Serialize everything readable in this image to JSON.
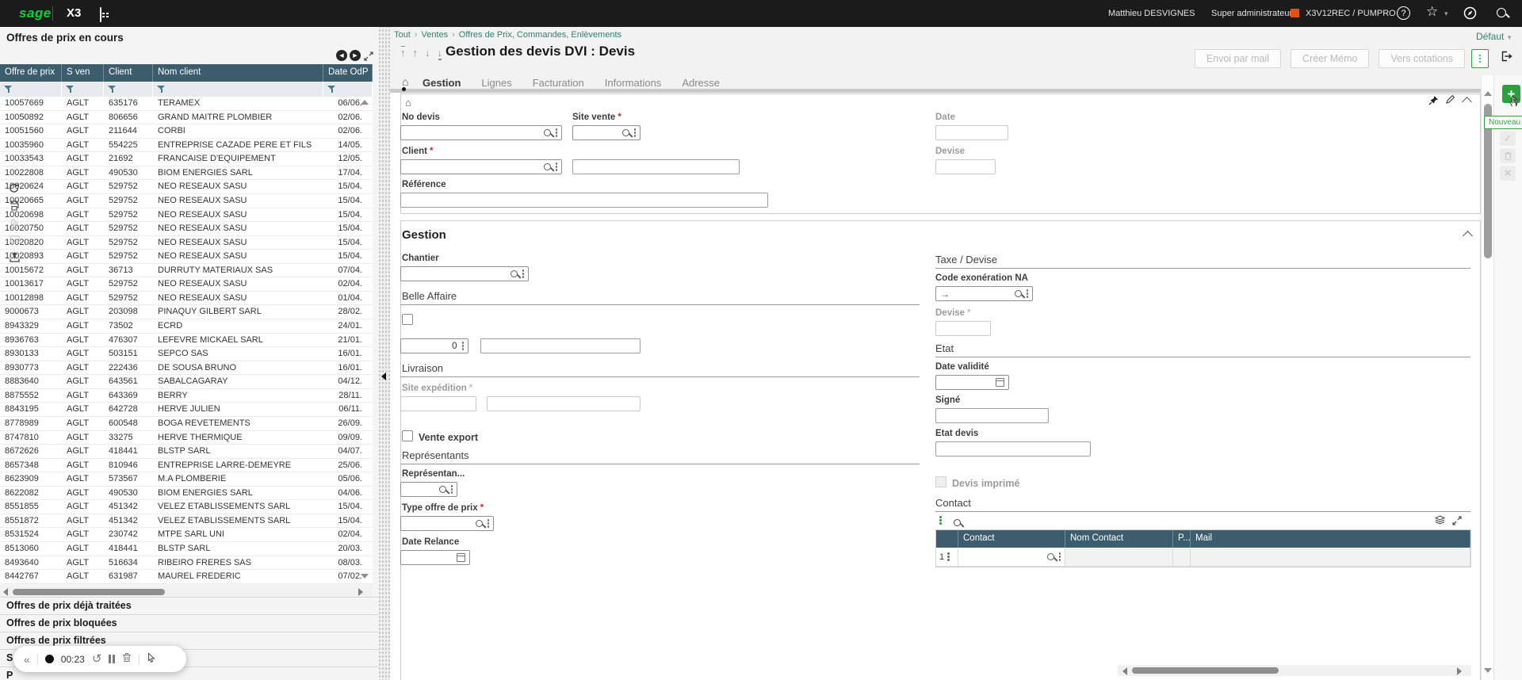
{
  "colors": {
    "accent_green": "#2aa13c",
    "topbar_bg": "#1b1b1b",
    "table_header_bg": "#3b5d6e",
    "link_teal": "#35806b",
    "env_orange": "#e05206"
  },
  "topbar": {
    "brand": "sage",
    "product": "X3",
    "user": "Matthieu DESVIGNES",
    "role": "Super administrateur",
    "environment": "X3V12REC / PUMPRO"
  },
  "context_bar": {
    "breadcrumb": [
      "Tout",
      "Ventes",
      "Offres de Prix, Commandes, Enlèvements"
    ],
    "view_label": "Défaut"
  },
  "left_panel": {
    "title": "Offres de prix en cours",
    "table": {
      "columns": [
        "Offre de prix",
        "S ven",
        "Client",
        "Nom client",
        "Date OdP"
      ],
      "rows": [
        [
          "10057669",
          "AGLT",
          "635176",
          "TERAMEX",
          "06/06."
        ],
        [
          "10050892",
          "AGLT",
          "806656",
          "GRAND MAITRE PLOMBIER",
          "02/06."
        ],
        [
          "10051560",
          "AGLT",
          "211644",
          "CORBI",
          "02/06."
        ],
        [
          "10035960",
          "AGLT",
          "554225",
          "ENTREPRISE CAZADE PERE ET FILS",
          "14/05."
        ],
        [
          "10033543",
          "AGLT",
          "21692",
          "FRANCAISE D'EQUIPEMENT",
          "12/05."
        ],
        [
          "10022808",
          "AGLT",
          "490530",
          "BIOM ENERGIES SARL",
          "17/04."
        ],
        [
          "10020624",
          "AGLT",
          "529752",
          "NEO RESEAUX SASU",
          "15/04."
        ],
        [
          "10020665",
          "AGLT",
          "529752",
          "NEO RESEAUX SASU",
          "15/04."
        ],
        [
          "10020698",
          "AGLT",
          "529752",
          "NEO RESEAUX SASU",
          "15/04."
        ],
        [
          "10020750",
          "AGLT",
          "529752",
          "NEO RESEAUX SASU",
          "15/04."
        ],
        [
          "10020820",
          "AGLT",
          "529752",
          "NEO RESEAUX SASU",
          "15/04."
        ],
        [
          "10020893",
          "AGLT",
          "529752",
          "NEO RESEAUX SASU",
          "15/04."
        ],
        [
          "10015672",
          "AGLT",
          "36713",
          "DURRUTY MATERIAUX SAS",
          "07/04."
        ],
        [
          "10013617",
          "AGLT",
          "529752",
          "NEO RESEAUX SASU",
          "02/04."
        ],
        [
          "10012898",
          "AGLT",
          "529752",
          "NEO RESEAUX SASU",
          "01/04."
        ],
        [
          "9000673",
          "AGLT",
          "203098",
          "PINAQUY GILBERT SARL",
          "28/02."
        ],
        [
          "8943329",
          "AGLT",
          "73502",
          "ECRD",
          "24/01."
        ],
        [
          "8936763",
          "AGLT",
          "476307",
          "LEFEVRE MICKAEL SARL",
          "21/01."
        ],
        [
          "8930133",
          "AGLT",
          "503151",
          "SEPCO SAS",
          "16/01."
        ],
        [
          "8930773",
          "AGLT",
          "222436",
          "DE SOUSA BRUNO",
          "16/01."
        ],
        [
          "8883640",
          "AGLT",
          "643561",
          "SABALCAGARAY",
          "04/12."
        ],
        [
          "8875552",
          "AGLT",
          "643369",
          "BERRY",
          "28/11."
        ],
        [
          "8843195",
          "AGLT",
          "642728",
          "HERVE JULIEN",
          "06/11."
        ],
        [
          "8778989",
          "AGLT",
          "600548",
          "BOGA REVETEMENTS",
          "26/09."
        ],
        [
          "8747810",
          "AGLT",
          "33275",
          "HERVE THERMIQUE",
          "09/09."
        ],
        [
          "8672626",
          "AGLT",
          "418441",
          "BLSTP SARL",
          "04/07."
        ],
        [
          "8657348",
          "AGLT",
          "810946",
          "ENTREPRISE LARRE-DEMEYRE",
          "25/06."
        ],
        [
          "8623909",
          "AGLT",
          "573567",
          "M.A PLOMBERIE",
          "05/06."
        ],
        [
          "8622082",
          "AGLT",
          "490530",
          "BIOM ENERGIES SARL",
          "04/06."
        ],
        [
          "8551855",
          "AGLT",
          "451342",
          "VELEZ ETABLISSEMENTS SARL",
          "15/04."
        ],
        [
          "8551872",
          "AGLT",
          "451342",
          "VELEZ ETABLISSEMENTS SARL",
          "15/04."
        ],
        [
          "8531524",
          "AGLT",
          "230742",
          "MTPE SARL UNI",
          "02/04."
        ],
        [
          "8513060",
          "AGLT",
          "418441",
          "BLSTP SARL",
          "20/03."
        ],
        [
          "8493640",
          "AGLT",
          "516634",
          "RIBEIRO FRERES SAS",
          "08/03."
        ],
        [
          "8442767",
          "AGLT",
          "631987",
          "MAUREL FREDERIC",
          "07/02."
        ]
      ]
    },
    "sections": [
      "Offres de prix déjà traitées",
      "Offres de prix bloquées",
      "Offres de prix filtrées",
      "S",
      "P"
    ]
  },
  "recorder": {
    "time": "00:23"
  },
  "page": {
    "title": "Gestion des devis DVI : Devis",
    "actions": [
      "Envoi par mail",
      "Créer Mémo",
      "Vers cotations"
    ],
    "tabs": [
      "Gestion",
      "Lignes",
      "Facturation",
      "Informations",
      "Adresse"
    ],
    "new_tooltip": "Nouveau"
  },
  "form": {
    "header": {
      "no_devis": "No devis",
      "site_vente": "Site vente",
      "date": "Date",
      "client": "Client",
      "devise": "Devise",
      "reference": "Référence"
    },
    "gestion": {
      "title": "Gestion",
      "chantier": "Chantier",
      "belle_affaire": "Belle Affaire",
      "quantity_value": "0",
      "livraison": "Livraison",
      "site_expedition": "Site expédition",
      "vente_export": "Vente export",
      "representants": "Représentants",
      "representant": "Représentan...",
      "type_offre": "Type offre de prix",
      "date_relance": "Date Relance"
    },
    "taxe_devise": {
      "title": "Taxe / Devise",
      "code_exoneration": "Code exonération NA",
      "devise": "Devise"
    },
    "etat": {
      "title": "Etat",
      "date_validite": "Date validité",
      "signe": "Signé",
      "etat_devis": "Etat devis",
      "devis_imprime": "Devis imprimé"
    },
    "contact": {
      "title": "Contact",
      "columns": [
        "Contact",
        "Nom Contact",
        "P...",
        "Mail"
      ],
      "first_row_number": "1"
    }
  }
}
